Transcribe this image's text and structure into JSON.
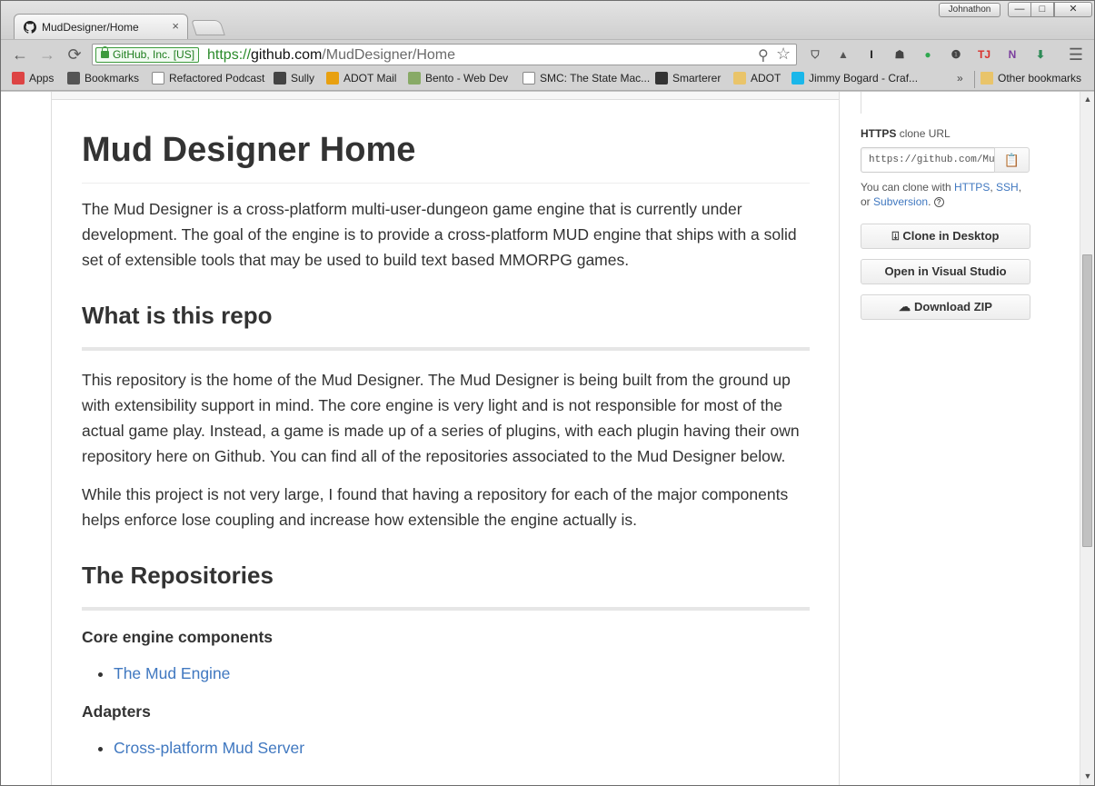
{
  "browser": {
    "tab_title": "MudDesigner/Home",
    "tab_close": "×",
    "profile_name": "Johnathon",
    "window_controls": {
      "minimize": "—",
      "maximize": "□",
      "close": "✕"
    },
    "nav": {
      "back": "←",
      "forward": "→",
      "reload": "⟳"
    },
    "ev_badge": "GitHub, Inc. [US]",
    "url": {
      "scheme": "https://",
      "host": "github.com",
      "path": "/MudDesigner/Home"
    },
    "menu_icon": "☰",
    "extensions": [
      {
        "icon": "pocket-icon",
        "glyph": "⛉",
        "color": "#555555"
      },
      {
        "icon": "bell-icon",
        "glyph": "▲",
        "color": "#555555"
      },
      {
        "icon": "instapaper-icon",
        "glyph": "I",
        "color": "#111111"
      },
      {
        "icon": "evernote-icon",
        "glyph": "☗",
        "color": "#444444"
      },
      {
        "icon": "green-dot-icon",
        "glyph": "●",
        "color": "#2fa84f"
      },
      {
        "icon": "onepassword-icon",
        "glyph": "❶",
        "color": "#444444"
      },
      {
        "icon": "tapp-icon",
        "glyph": "TJ",
        "color": "#d9312b"
      },
      {
        "icon": "onenote-icon",
        "glyph": "N",
        "color": "#7b3f9e"
      },
      {
        "icon": "download-icon",
        "glyph": "⬇",
        "color": "#2e8b57"
      }
    ]
  },
  "bookmarks": {
    "items": [
      {
        "label": "Apps",
        "icon": "apps-grid-icon",
        "color": "#d44"
      },
      {
        "label": "Bookmarks",
        "icon": "star-icon",
        "color": "#555"
      },
      {
        "label": "Refactored Podcast",
        "icon": "page-icon",
        "color": "#fff"
      },
      {
        "label": "Sully",
        "icon": "cube-icon",
        "color": "#444"
      },
      {
        "label": "ADOT Mail",
        "icon": "outlook-icon",
        "color": "#e8a010"
      },
      {
        "label": "Bento - Web Dev",
        "icon": "bento-icon",
        "color": "#8a6"
      },
      {
        "label": "SMC: The State Mac...",
        "icon": "page-icon",
        "color": "#fff"
      },
      {
        "label": "Smarterer",
        "icon": "owl-icon",
        "color": "#333"
      },
      {
        "label": "ADOT",
        "icon": "folder-icon",
        "color": "#e9c46a"
      },
      {
        "label": "Jimmy Bogard - Craf...",
        "icon": "vimeo-icon",
        "color": "#1ab7ea"
      }
    ],
    "overflow": "»",
    "other": "Other bookmarks"
  },
  "readme": {
    "title": "Mud Designer Home",
    "intro": "The Mud Designer is a cross-platform multi-user-dungeon game engine that is currently under development. The goal of the engine is to provide a cross-platform MUD engine that ships with a solid set of extensible tools that may be used to build text based MMORPG games.",
    "section1_heading": "What is this repo",
    "section1_p1": "This repository is the home of the Mud Designer. The Mud Designer is being built from the ground up with extensibility support in mind. The core engine is very light and is not responsible for most of the actual game play. Instead, a game is made up of a series of plugins, with each plugin having their own repository here on Github. You can find all of the repositories associated to the Mud Designer below.",
    "section1_p2": "While this project is not very large, I found that having a repository for each of the major components helps enforce lose coupling and increase how extensible the engine actually is.",
    "section2_heading": "The Repositories",
    "core_heading": "Core engine components",
    "core_links": [
      "The Mud Engine"
    ],
    "adapters_heading": "Adapters",
    "adapter_links": [
      "Cross-platform Mud Server"
    ]
  },
  "sidebar": {
    "clone_protocol": "HTTPS",
    "clone_label": "clone URL",
    "clone_url": "https://github.com/MudDesigner/Home.git",
    "clone_help_prefix": "You can clone with",
    "clone_help_https": "HTTPS",
    "clone_help_ssh": "SSH",
    "clone_help_or": "or",
    "clone_help_svn": "Subversion",
    "clone_desktop": "Clone in Desktop",
    "open_vs": "Open in Visual Studio",
    "download_zip": "Download ZIP"
  },
  "scrollbar": {
    "up_arrow": "▲",
    "down_arrow": "▼",
    "position": 0.4
  }
}
